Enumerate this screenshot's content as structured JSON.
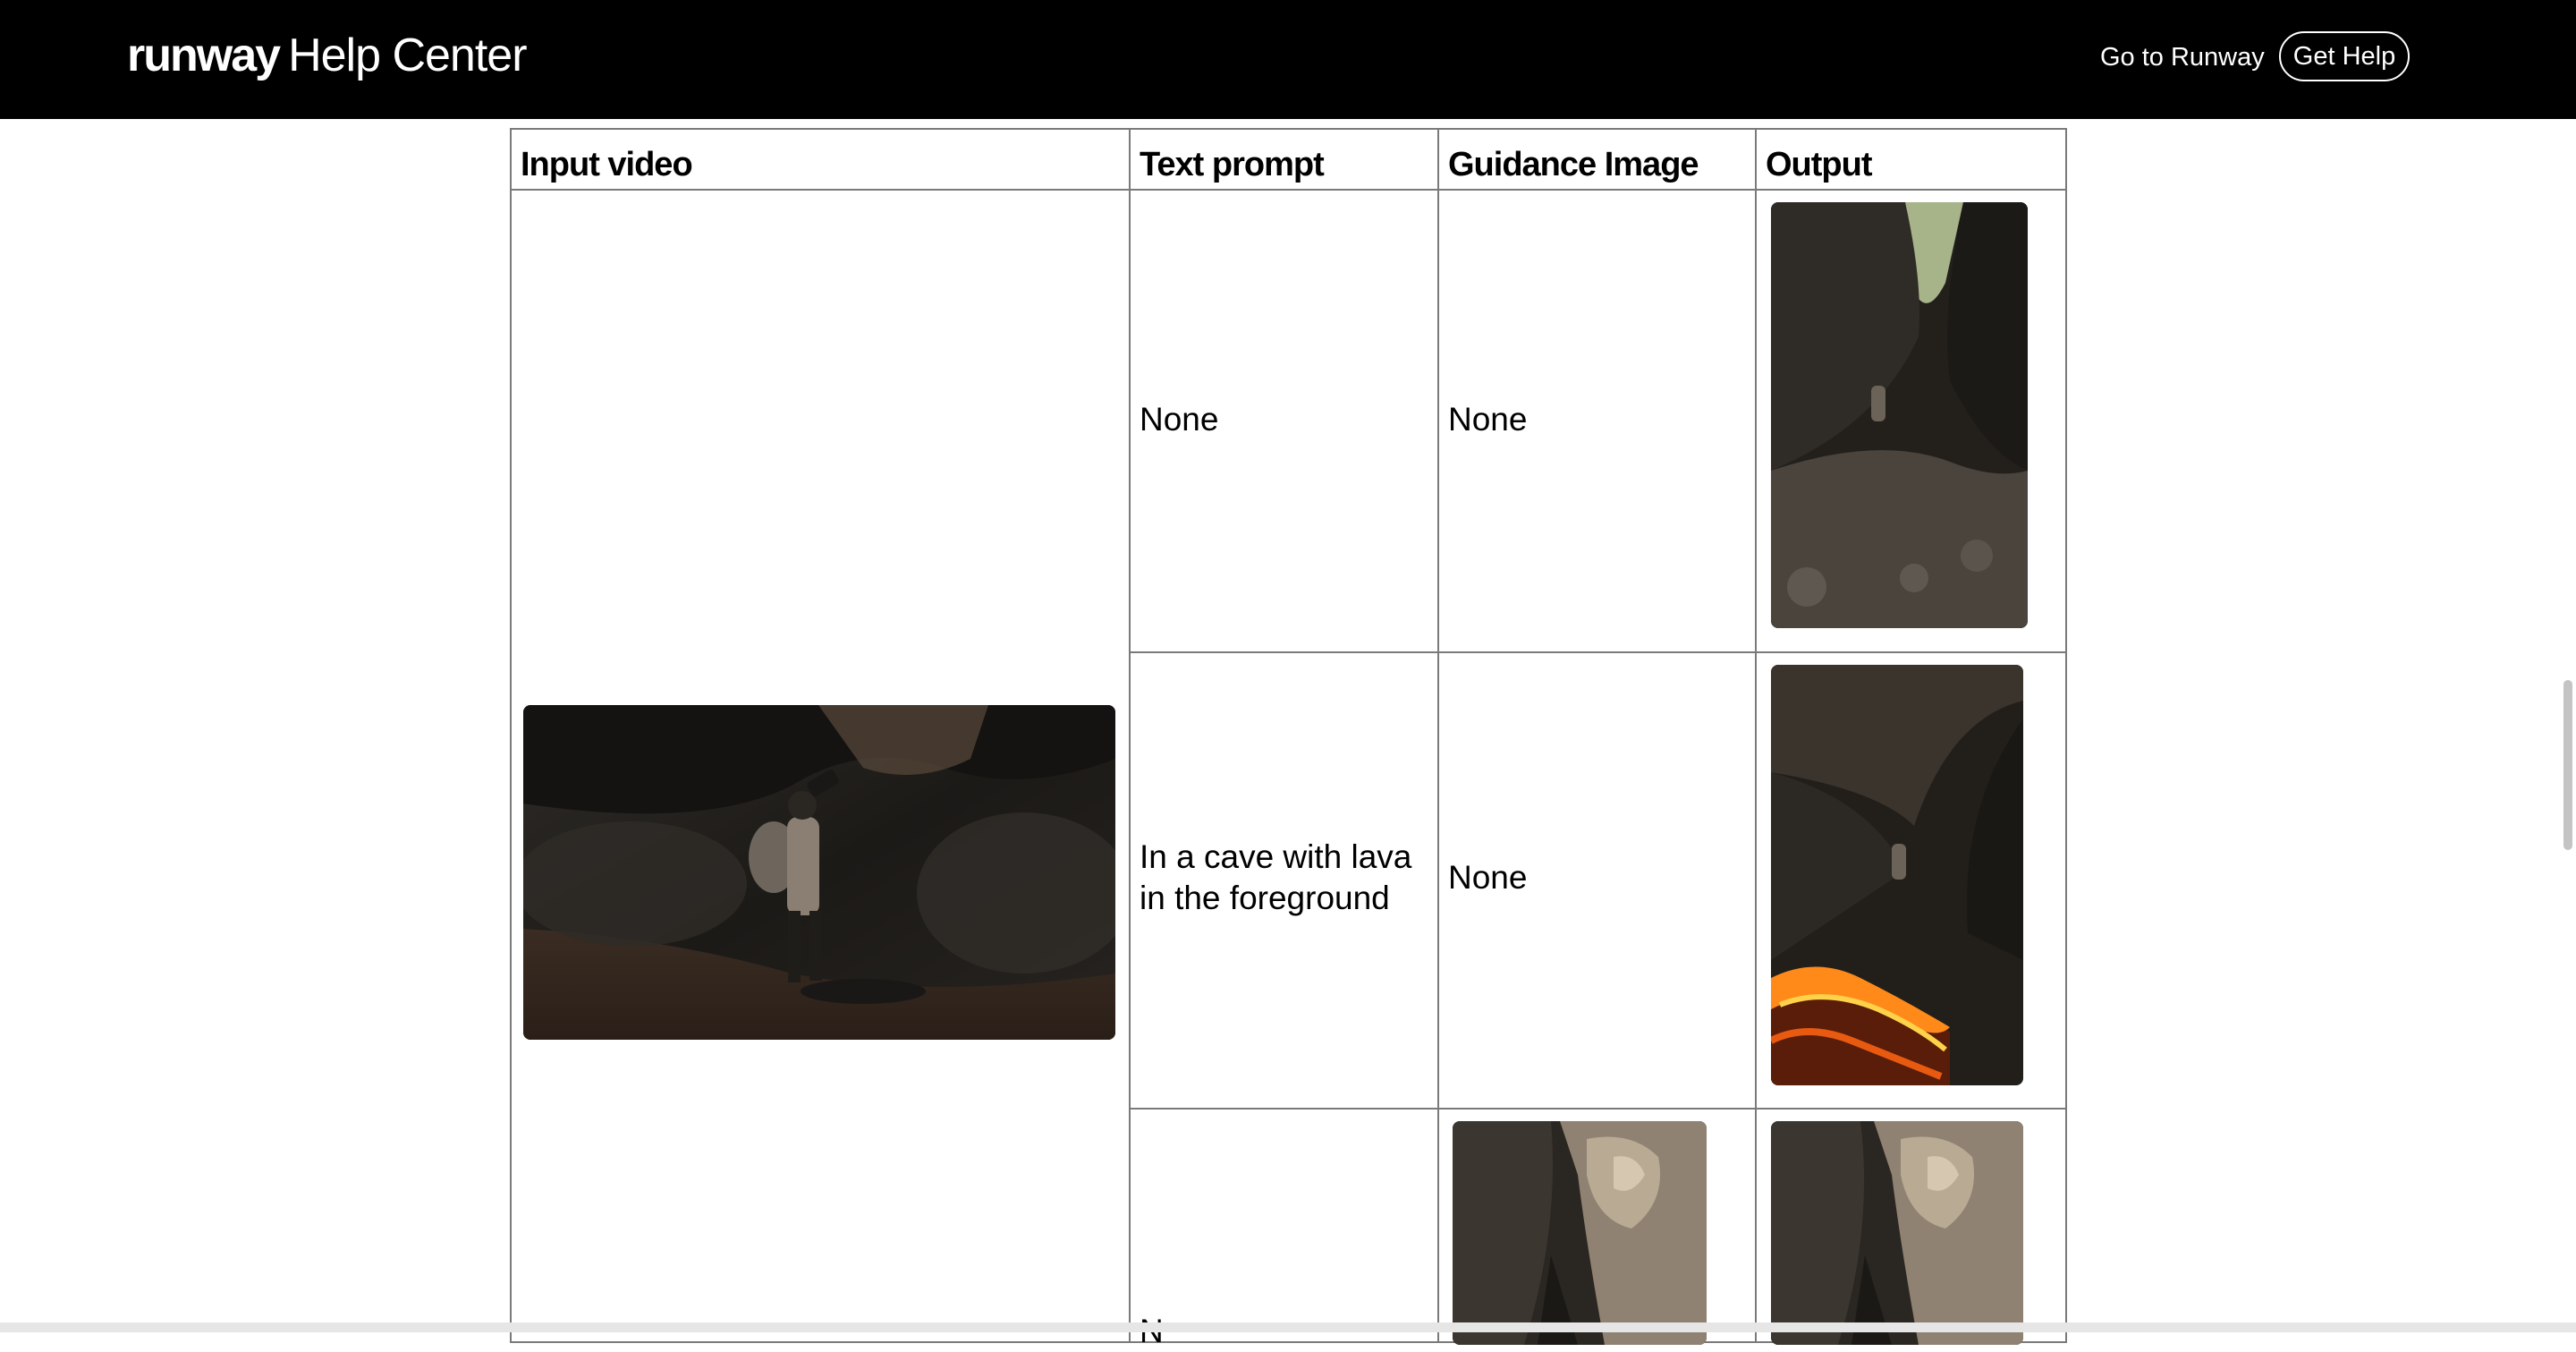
{
  "header": {
    "logo": "runway",
    "subtitle": "Help Center",
    "nav_link": "Go to Runway",
    "help_button": "Get Help"
  },
  "table": {
    "columns": [
      "Input video",
      "Text prompt",
      "Guidance Image",
      "Output"
    ],
    "rows": [
      {
        "text_prompt": "None",
        "guidance_image": "None"
      },
      {
        "text_prompt": "In a cave with lava in the foreground",
        "guidance_image": "None"
      },
      {
        "text_prompt": "N",
        "guidance_image": ""
      }
    ]
  },
  "colors": {
    "header_bg": "#000000",
    "border": "#7a7a7a",
    "lava": "#ff8a1a"
  },
  "icons": [
    "cave-photo",
    "lava-cave-photo",
    "rock-formation-photo"
  ]
}
